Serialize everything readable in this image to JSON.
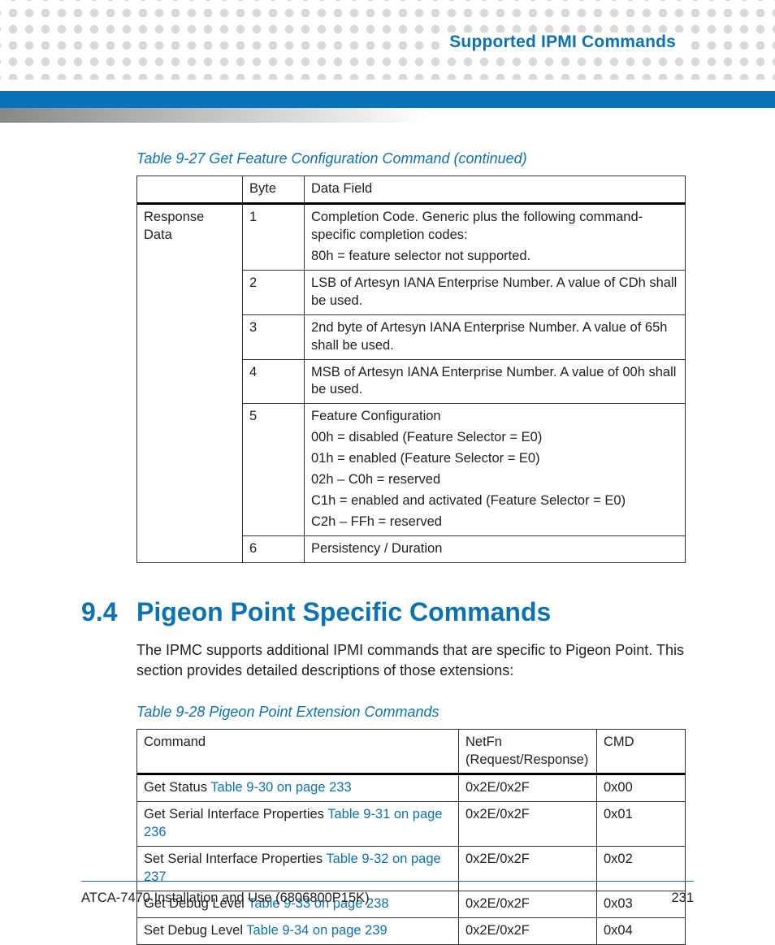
{
  "header": {
    "chapter": "Supported IPMI Commands"
  },
  "table927": {
    "caption": "Table 9-27 Get Feature Configuration Command (continued)",
    "head": {
      "col1": "",
      "col2": "Byte",
      "col3": "Data Field"
    },
    "group": "Response Data",
    "rows": [
      {
        "byte": "1",
        "lines": [
          "Completion Code. Generic plus the following command-specific completion codes:",
          "80h = feature selector not supported."
        ]
      },
      {
        "byte": "2",
        "lines": [
          "LSB of Artesyn IANA Enterprise Number. A value of CDh shall be used."
        ]
      },
      {
        "byte": "3",
        "lines": [
          "2nd byte of Artesyn IANA Enterprise Number. A value of 65h shall be used."
        ]
      },
      {
        "byte": "4",
        "lines": [
          "MSB of Artesyn IANA Enterprise Number. A value of 00h shall be used."
        ]
      },
      {
        "byte": "5",
        "lines": [
          "Feature Configuration",
          "00h = disabled (Feature Selector = E0)",
          "01h = enabled (Feature Selector = E0)",
          "02h – C0h = reserved",
          "C1h = enabled and activated (Feature Selector = E0)",
          "C2h – FFh = reserved"
        ]
      },
      {
        "byte": "6",
        "lines": [
          "Persistency / Duration"
        ]
      }
    ]
  },
  "section": {
    "number": "9.4",
    "title": "Pigeon Point Specific Commands",
    "intro": "The IPMC supports additional IPMI commands that are specific to Pigeon Point. This section provides detailed descriptions of those extensions:"
  },
  "table928": {
    "caption": "Table 9-28 Pigeon Point Extension Commands",
    "head": {
      "col1": "Command",
      "col2": "NetFn (Request/Response)",
      "col3": "CMD"
    },
    "rows": [
      {
        "cmd_text": "Get Status ",
        "cmd_link": "Table 9-30 on page 233",
        "netfn": "0x2E/0x2F",
        "cmd": "0x00"
      },
      {
        "cmd_text": "Get Serial Interface Properties ",
        "cmd_link": "Table 9-31 on page 236",
        "netfn": "0x2E/0x2F",
        "cmd": "0x01"
      },
      {
        "cmd_text": "Set Serial Interface Properties ",
        "cmd_link": "Table 9-32 on page 237",
        "netfn": "0x2E/0x2F",
        "cmd": "0x02"
      },
      {
        "cmd_text": "Get Debug Level ",
        "cmd_link": "Table 9-33 on page 238",
        "netfn": "0x2E/0x2F",
        "cmd": "0x03"
      },
      {
        "cmd_text": "Set Debug Level ",
        "cmd_link": "Table 9-34 on page 239",
        "netfn": "0x2E/0x2F",
        "cmd": "0x04"
      }
    ]
  },
  "footer": {
    "left": "ATCA-7470 Installation and Use (6806800P15K)",
    "page": "231"
  }
}
